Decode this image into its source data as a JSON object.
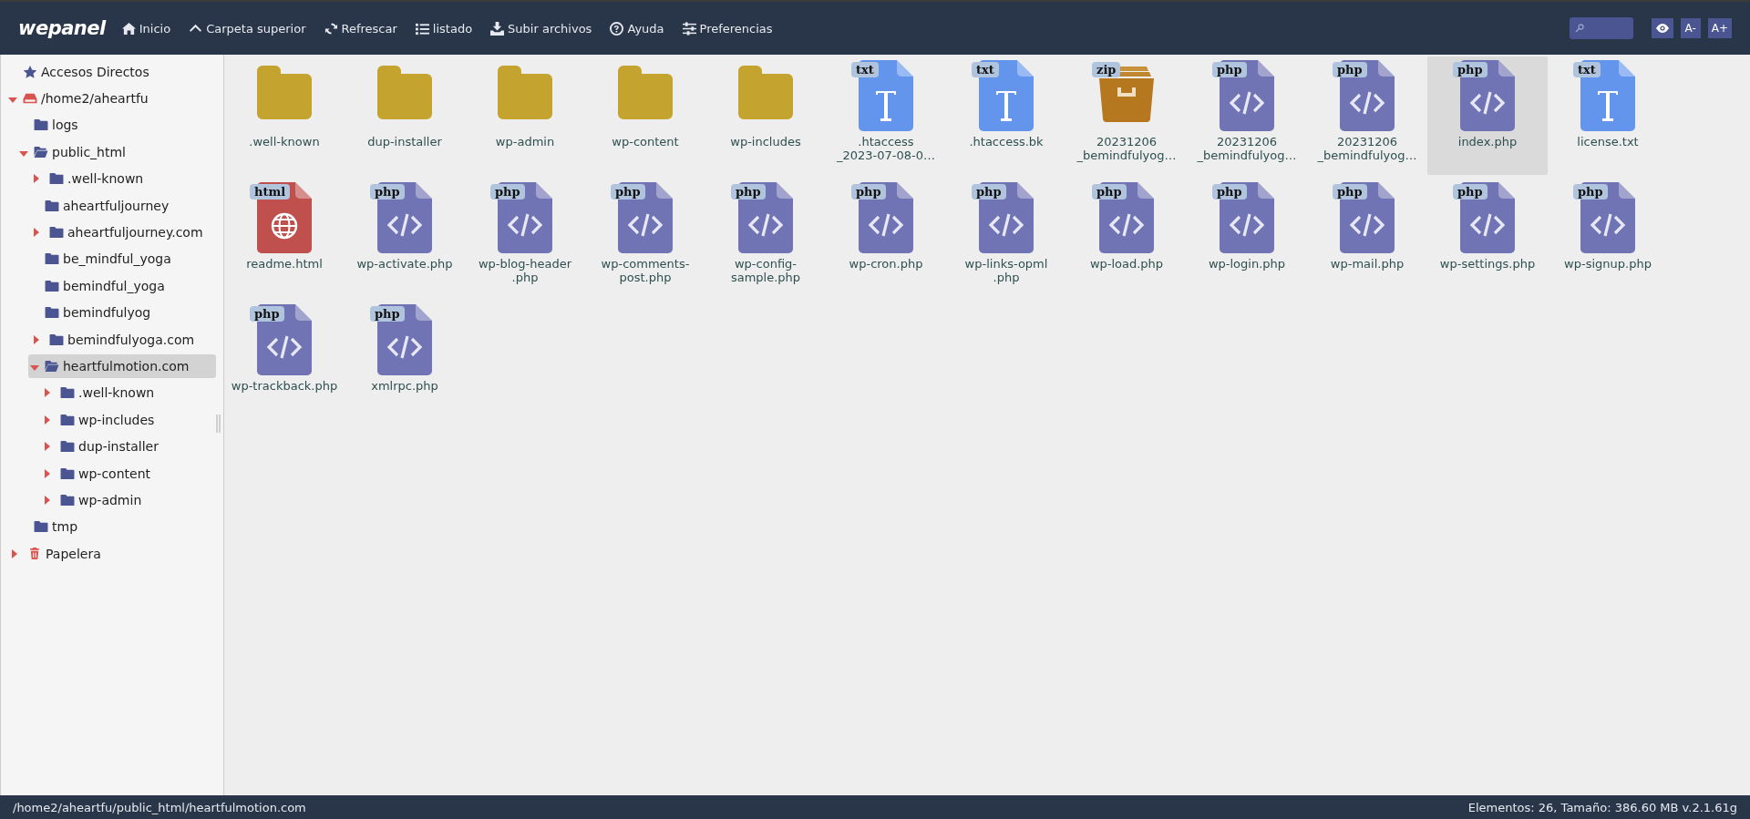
{
  "topbar": {
    "logo": "wepanel",
    "nav": [
      {
        "label": "Inicio"
      },
      {
        "label": "Carpeta superior"
      },
      {
        "label": "Refrescar"
      },
      {
        "label": "listado"
      },
      {
        "label": "Subir archivos"
      },
      {
        "label": "Ayuda"
      },
      {
        "label": "Preferencias"
      }
    ],
    "tools": [
      {
        "kind": "eye"
      },
      {
        "kind": "text",
        "label": "A-"
      },
      {
        "kind": "text",
        "label": "A+"
      }
    ]
  },
  "sidebar": {
    "tree": [
      {
        "kind": "shortcuts",
        "label": "Accesos Directos",
        "selected": false
      },
      {
        "kind": "drive",
        "label": "/home2/aheartfu",
        "expanded": true,
        "selected": false,
        "children": [
          {
            "kind": "folder",
            "label": "logs",
            "selected": false
          },
          {
            "kind": "folder",
            "label": "public_html",
            "expanded": true,
            "selected": false,
            "children": [
              {
                "kind": "folder",
                "label": ".well-known",
                "expanded": false,
                "selected": false
              },
              {
                "kind": "folder",
                "label": "aheartfuljourney",
                "selected": false
              },
              {
                "kind": "folder",
                "label": "aheartfuljourney.com",
                "expanded": false,
                "selected": false
              },
              {
                "kind": "folder",
                "label": "be_mindful_yoga",
                "selected": false
              },
              {
                "kind": "folder",
                "label": "bemindful_yoga",
                "selected": false
              },
              {
                "kind": "folder",
                "label": "bemindfulyog",
                "selected": false
              },
              {
                "kind": "folder",
                "label": "bemindfulyoga.com",
                "expanded": false,
                "selected": false
              },
              {
                "kind": "folder",
                "label": "heartfulmotion.com",
                "expanded": true,
                "selected": true,
                "children": [
                  {
                    "kind": "folder",
                    "label": ".well-known",
                    "expanded": false,
                    "selected": false
                  },
                  {
                    "kind": "folder",
                    "label": "wp-includes",
                    "expanded": false,
                    "selected": false
                  },
                  {
                    "kind": "folder",
                    "label": "dup-installer",
                    "expanded": false,
                    "selected": false
                  },
                  {
                    "kind": "folder",
                    "label": "wp-content",
                    "expanded": false,
                    "selected": false
                  },
                  {
                    "kind": "folder",
                    "label": "wp-admin",
                    "expanded": false,
                    "selected": false
                  }
                ]
              }
            ]
          },
          {
            "kind": "folder",
            "label": "tmp",
            "selected": false
          }
        ]
      },
      {
        "kind": "trash",
        "label": "Papelera",
        "expanded": false,
        "selected": false
      }
    ]
  },
  "files": [
    {
      "kind": "folder",
      "lines": [
        ".well-known"
      ],
      "selected": false
    },
    {
      "kind": "folder",
      "lines": [
        "dup-installer"
      ],
      "selected": false
    },
    {
      "kind": "folder",
      "lines": [
        "wp-admin"
      ],
      "selected": false
    },
    {
      "kind": "folder",
      "lines": [
        "wp-content"
      ],
      "selected": false
    },
    {
      "kind": "folder",
      "lines": [
        "wp-includes"
      ],
      "selected": false
    },
    {
      "kind": "txt",
      "badge": "txt",
      "lines": [
        ".htaccess",
        "_2023-07-08-0…"
      ],
      "selected": false
    },
    {
      "kind": "txt",
      "badge": "txt",
      "lines": [
        ".htaccess.bk"
      ],
      "selected": false
    },
    {
      "kind": "zip",
      "badge": "zip",
      "lines": [
        "20231206",
        "_bemindfulyog…"
      ],
      "selected": false
    },
    {
      "kind": "php",
      "badge": "php",
      "lines": [
        "20231206",
        "_bemindfulyog…"
      ],
      "selected": false
    },
    {
      "kind": "php",
      "badge": "php",
      "lines": [
        "20231206",
        "_bemindfulyog…"
      ],
      "selected": false
    },
    {
      "kind": "php",
      "badge": "php",
      "lines": [
        "index.php"
      ],
      "selected": true
    },
    {
      "kind": "txt",
      "badge": "txt",
      "lines": [
        "license.txt"
      ],
      "selected": false
    },
    {
      "kind": "html",
      "badge": "html",
      "lines": [
        "readme.html"
      ],
      "selected": false
    },
    {
      "kind": "php",
      "badge": "php",
      "lines": [
        "wp-activate.php"
      ],
      "selected": false
    },
    {
      "kind": "php",
      "badge": "php",
      "lines": [
        "wp-blog-header",
        ".php"
      ],
      "selected": false
    },
    {
      "kind": "php",
      "badge": "php",
      "lines": [
        "wp-comments-",
        "post.php"
      ],
      "selected": false
    },
    {
      "kind": "php",
      "badge": "php",
      "lines": [
        "wp-config-",
        "sample.php"
      ],
      "selected": false
    },
    {
      "kind": "php",
      "badge": "php",
      "lines": [
        "wp-cron.php"
      ],
      "selected": false
    },
    {
      "kind": "php",
      "badge": "php",
      "lines": [
        "wp-links-opml",
        ".php"
      ],
      "selected": false
    },
    {
      "kind": "php",
      "badge": "php",
      "lines": [
        "wp-load.php"
      ],
      "selected": false
    },
    {
      "kind": "php",
      "badge": "php",
      "lines": [
        "wp-login.php"
      ],
      "selected": false
    },
    {
      "kind": "php",
      "badge": "php",
      "lines": [
        "wp-mail.php"
      ],
      "selected": false
    },
    {
      "kind": "php",
      "badge": "php",
      "lines": [
        "wp-settings.php"
      ],
      "selected": false
    },
    {
      "kind": "php",
      "badge": "php",
      "lines": [
        "wp-signup.php"
      ],
      "selected": false
    },
    {
      "kind": "php",
      "badge": "php",
      "lines": [
        "wp-trackback.php"
      ],
      "selected": false
    },
    {
      "kind": "php",
      "badge": "php",
      "lines": [
        "xmlrpc.php"
      ],
      "selected": false
    }
  ],
  "status_bar": {
    "path": "/home2/aheartfu/public_html/heartfulmotion.com",
    "summary": "Elementos: 26, Tamaño: 386.60 MB v.2.1.61g"
  }
}
